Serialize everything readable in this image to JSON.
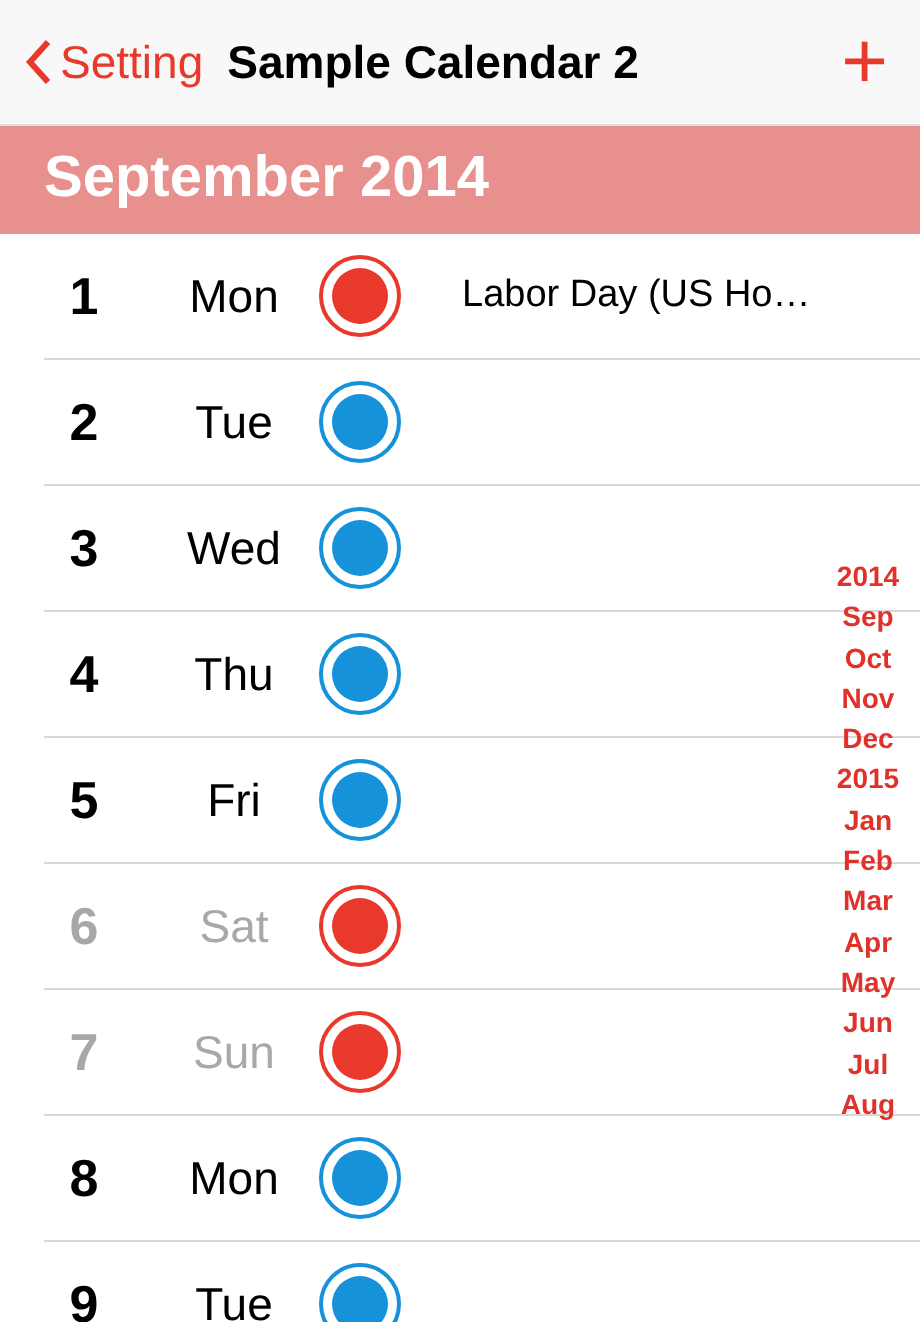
{
  "nav": {
    "back": "Setting",
    "title": "Sample Calendar 2",
    "add": "+"
  },
  "month": "September 2014",
  "days": [
    {
      "date": "1",
      "weekday": "Mon",
      "color": "#e8392c",
      "dimmed": false,
      "event": "Labor Day (US Ho…"
    },
    {
      "date": "2",
      "weekday": "Tue",
      "color": "#1592d9",
      "dimmed": false
    },
    {
      "date": "3",
      "weekday": "Wed",
      "color": "#1592d9",
      "dimmed": false
    },
    {
      "date": "4",
      "weekday": "Thu",
      "color": "#1592d9",
      "dimmed": false
    },
    {
      "date": "5",
      "weekday": "Fri",
      "color": "#1592d9",
      "dimmed": false
    },
    {
      "date": "6",
      "weekday": "Sat",
      "color": "#e8392c",
      "dimmed": true
    },
    {
      "date": "7",
      "weekday": "Sun",
      "color": "#e8392c",
      "dimmed": true
    },
    {
      "date": "8",
      "weekday": "Mon",
      "color": "#1592d9",
      "dimmed": false
    },
    {
      "date": "9",
      "weekday": "Tue",
      "color": "#1592d9",
      "dimmed": false
    }
  ],
  "index": [
    "2014",
    "Sep",
    "Oct",
    "Nov",
    "Dec",
    "2015",
    "Jan",
    "Feb",
    "Mar",
    "Apr",
    "May",
    "Jun",
    "Jul",
    "Aug"
  ]
}
